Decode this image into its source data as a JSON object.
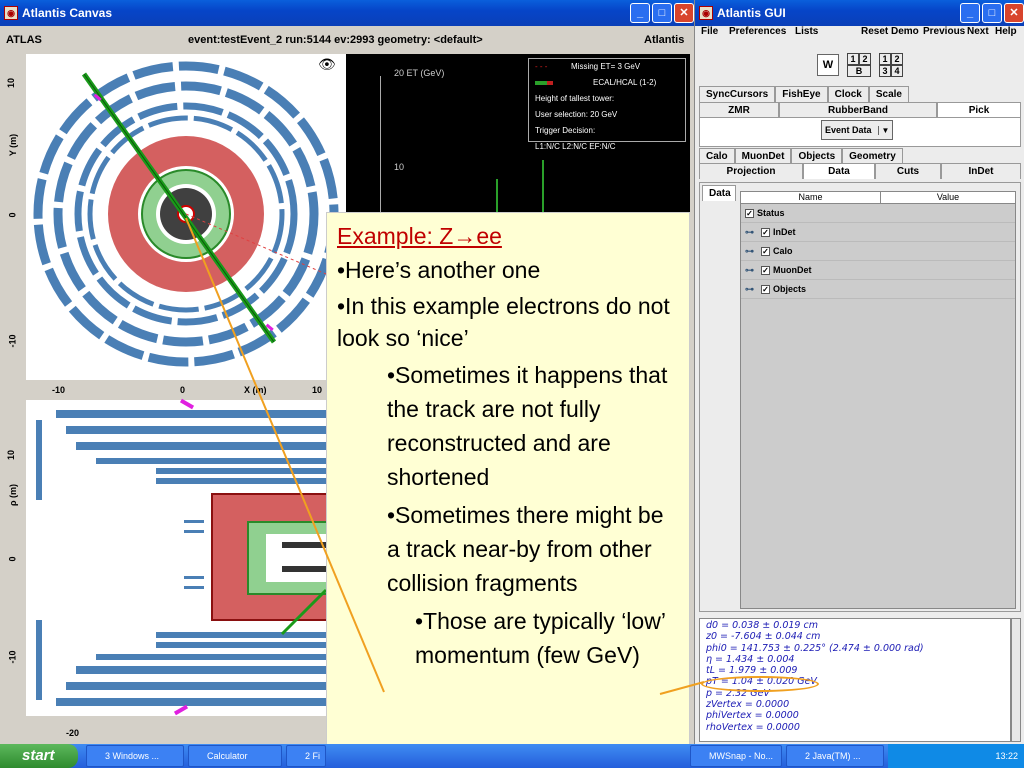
{
  "canvas": {
    "title": "Atlantis Canvas",
    "left_label": "ATLAS",
    "event": "event:testEvent_2 run:5144 ev:2993  geometry: <default>",
    "right_label": "Atlantis",
    "top_ylabel": "Y (m)",
    "top_xlabel": "X (m)",
    "bottom_ylabel": "ρ (m)",
    "top_yticks": [
      "10",
      "0",
      "-10"
    ],
    "top_xticks": [
      "-10",
      "0",
      "10"
    ],
    "bottom_yticks": [
      "10",
      "0",
      "-10"
    ],
    "bottom_xticks": [
      "-20"
    ],
    "lego_ticks": [
      "20 ET (GeV)",
      "10"
    ],
    "legend": [
      "Missing ET= 3 GeV",
      "ECAL/HCAL (1-2)",
      "Height of tallest tower:",
      "User selection: 20 GeV",
      "Trigger Decision:",
      "L1:N/C L2:N/C EF:N/C"
    ]
  },
  "gui": {
    "title": "Atlantis GUI",
    "menu": [
      "File",
      "Preferences",
      "Lists",
      "Reset",
      "Demo",
      "Previous",
      "Next",
      "Help"
    ],
    "w_label": "W",
    "grid1": [
      "1",
      "2",
      "B"
    ],
    "grid2": [
      "1",
      "2",
      "3",
      "4"
    ],
    "tabs1": [
      "SyncCursors",
      "FishEye",
      "Clock",
      "Scale"
    ],
    "tabs2": [
      "ZMR",
      "RubberBand",
      "Pick"
    ],
    "event_data": "Event Data",
    "tabs3": [
      "Calo",
      "MuonDet",
      "Objects",
      "Geometry"
    ],
    "tabs4": [
      "Projection",
      "Data",
      "Cuts",
      "InDet"
    ],
    "data_tab": "Data",
    "col_name": "Name",
    "col_value": "Value",
    "rows": [
      "Status",
      "InDet",
      "Calo",
      "MuonDet",
      "Objects"
    ],
    "info": [
      "d0 = 0.038 ± 0.019 cm",
      "z0 = -7.604 ± 0.044 cm",
      "phi0 = 141.753 ± 0.225°  (2.474 ± 0.000 rad)",
      "η = 1.434 ± 0.004",
      "tL = 1.979 ± 0.009",
      "pT = 1.04 ± 0.020 GeV",
      "p  = 2.32 GeV",
      "zVertex = 0.0000",
      "phiVertex = 0.0000",
      "rhoVertex = 0.0000"
    ]
  },
  "slide": {
    "title": "Example: Z→ee",
    "b1": "•Here’s another one",
    "b2": "•In this example electrons do not look so ‘nice’",
    "b3": "•Sometimes it happens that the track are not fully reconstructed and are shortened",
    "b4": "•Sometimes there might be a track near-by from other collision fragments",
    "b5": "•Those are typically ‘low’ momentum (few GeV)"
  },
  "taskbar": {
    "start": "start",
    "items": [
      "3 Windows ...",
      "Calculator",
      "2 Fi",
      "MWSnap - No...",
      "2 Java(TM) ..."
    ],
    "clock": "13:22"
  },
  "colors": {
    "slide_bg": "#ffffd4",
    "title_red": "#c00000",
    "highlight": "#f0a020"
  }
}
